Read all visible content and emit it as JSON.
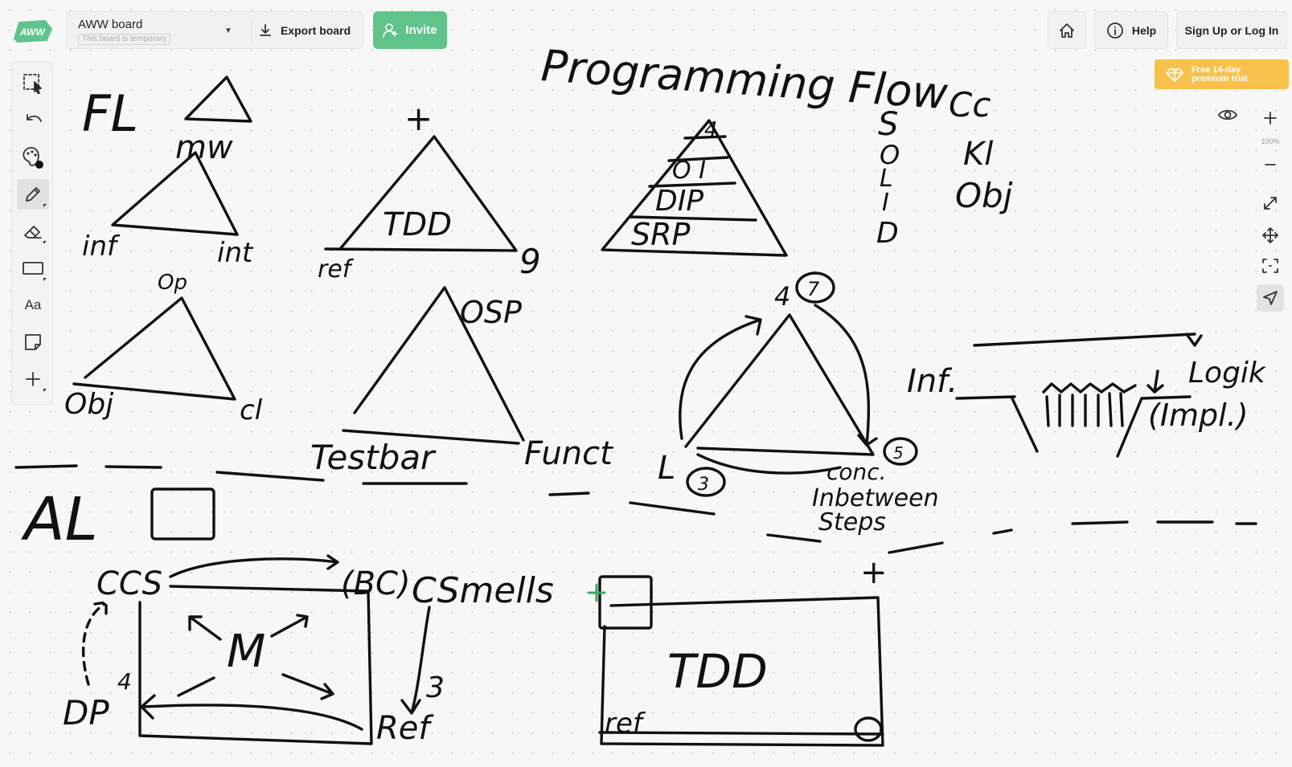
{
  "app": {
    "logo_text": "AWW",
    "colors": {
      "brand_green": "#5fc38a",
      "trial_yellow": "#f8c14b",
      "cursor_green": "#3aa864"
    }
  },
  "header": {
    "board_title": "AWW board",
    "board_subtitle": "This board is temporary",
    "board_menu_icon": "caret-down-icon",
    "export_label": "Export board",
    "export_icon": "download-icon",
    "invite_label": "Invite",
    "invite_icon": "add-user-icon",
    "home_icon": "home-icon",
    "help_label": "Help",
    "help_icon": "info-icon",
    "signin_label": "Sign Up or Log In",
    "trial_line1": "Free 14-day",
    "trial_line2": "premium trial",
    "trial_icon": "diamond-icon"
  },
  "toolbar": {
    "tools": [
      {
        "name": "select",
        "icon": "select-icon"
      },
      {
        "name": "undo",
        "icon": "undo-icon"
      },
      {
        "name": "color",
        "icon": "palette-icon"
      },
      {
        "name": "pen",
        "icon": "pencil-icon",
        "active": true
      },
      {
        "name": "eraser",
        "icon": "eraser-icon"
      },
      {
        "name": "shape",
        "icon": "rectangle-icon"
      },
      {
        "name": "text",
        "icon": "text-icon",
        "label": "Aa"
      },
      {
        "name": "sticky",
        "icon": "sticky-note-icon"
      },
      {
        "name": "more",
        "icon": "plus-icon"
      }
    ]
  },
  "view_controls": {
    "zoom_level": "100%",
    "icons": [
      "eye-icon",
      "zoom-in-icon",
      "zoom-out-icon",
      "fullscreen-icon",
      "move-icon",
      "fit-icon",
      "navigate-icon"
    ]
  },
  "board_handwriting": {
    "title": "Programming Flow",
    "fl": "FL",
    "mw": "mw",
    "inf": "inf",
    "int": "int",
    "plus1": "+",
    "tdd": "TDD",
    "ref": "ref",
    "nine": "9",
    "pyr_top": "4",
    "pyr_l2": "O I",
    "pyr_l3": "DIP",
    "pyr_l4": "SRP",
    "solid_s": "S",
    "solid_o": "O",
    "solid_l": "L",
    "solid_i": "I",
    "solid_d": "D",
    "cc": "Cc",
    "kl": "Kl",
    "obj": "Obj",
    "op": "Op",
    "obj2": "Obj",
    "cl": "cl",
    "osp": "OSP",
    "testbar": "Testbar",
    "funct": "Funct",
    "four": "4",
    "seven": "7",
    "l": "L",
    "three": "3",
    "five": "5",
    "conc1": "conc.",
    "conc2": "Inbetween",
    "conc3": "Steps",
    "inf2": "Inf.",
    "logik": "Logik",
    "impl": "(Impl.)",
    "al": "AL",
    "ccs": "CCS",
    "bc": "(BC)",
    "csmells": "CSmells",
    "m": "M",
    "dp": "DP",
    "four2": "4",
    "b3": "3",
    "ref2": "Ref",
    "tdd2": "TDD",
    "ref3": "ref",
    "plus2": "+"
  }
}
